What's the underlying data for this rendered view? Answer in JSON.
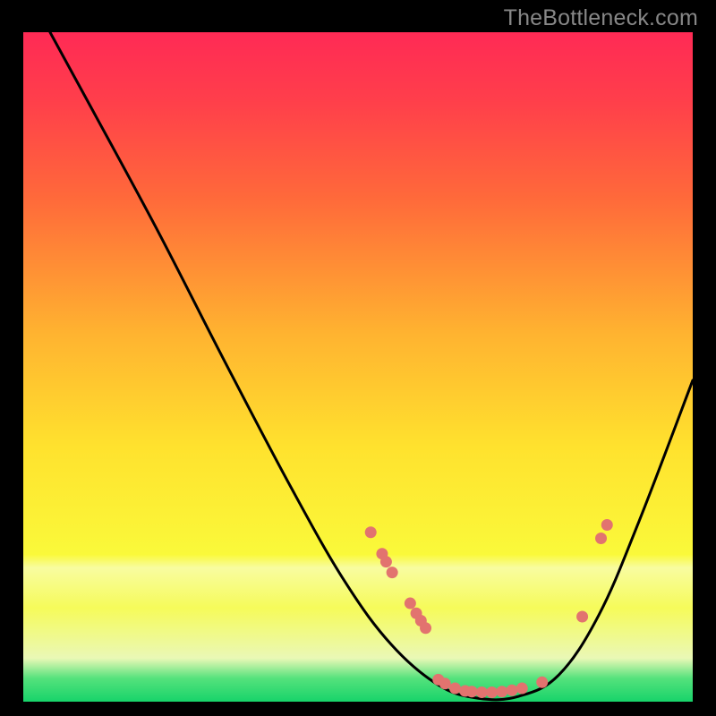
{
  "watermark": "TheBottleneck.com",
  "chart_data": {
    "type": "line",
    "title": "",
    "xlabel": "",
    "ylabel": "",
    "xlim": [
      0,
      100
    ],
    "ylim": [
      0,
      100
    ],
    "gradient_stops": [
      {
        "offset": 0.0,
        "color": "#ff2a55"
      },
      {
        "offset": 0.1,
        "color": "#ff3e4b"
      },
      {
        "offset": 0.25,
        "color": "#ff6a3a"
      },
      {
        "offset": 0.45,
        "color": "#ffb330"
      },
      {
        "offset": 0.62,
        "color": "#ffe22e"
      },
      {
        "offset": 0.78,
        "color": "#faf93a"
      },
      {
        "offset": 0.8,
        "color": "#f8fca0"
      },
      {
        "offset": 0.86,
        "color": "#f6fb5a"
      },
      {
        "offset": 0.935,
        "color": "#eaf8b6"
      },
      {
        "offset": 0.965,
        "color": "#55e27c"
      },
      {
        "offset": 1.0,
        "color": "#17d36a"
      }
    ],
    "series": [
      {
        "name": "bottleneck-curve",
        "color": "#000000",
        "stroke_width": 3,
        "points": [
          {
            "x": 4.0,
            "y": 100.0
          },
          {
            "x": 10.0,
            "y": 89.0
          },
          {
            "x": 20.0,
            "y": 70.5
          },
          {
            "x": 30.0,
            "y": 51.0
          },
          {
            "x": 40.0,
            "y": 32.0
          },
          {
            "x": 48.0,
            "y": 18.0
          },
          {
            "x": 55.0,
            "y": 8.5
          },
          {
            "x": 62.0,
            "y": 2.5
          },
          {
            "x": 68.0,
            "y": 0.5
          },
          {
            "x": 74.0,
            "y": 0.8
          },
          {
            "x": 80.0,
            "y": 4.0
          },
          {
            "x": 86.0,
            "y": 13.0
          },
          {
            "x": 92.0,
            "y": 27.0
          },
          {
            "x": 100.0,
            "y": 48.0
          }
        ]
      }
    ],
    "markers": {
      "color": "#e2736f",
      "radius": 6.5,
      "points": [
        {
          "x": 51.9,
          "y": 25.3
        },
        {
          "x": 53.6,
          "y": 22.1
        },
        {
          "x": 54.2,
          "y": 20.9
        },
        {
          "x": 55.1,
          "y": 19.3
        },
        {
          "x": 57.8,
          "y": 14.7
        },
        {
          "x": 58.7,
          "y": 13.2
        },
        {
          "x": 59.4,
          "y": 12.1
        },
        {
          "x": 60.1,
          "y": 11.0
        },
        {
          "x": 62.0,
          "y": 3.3
        },
        {
          "x": 63.0,
          "y": 2.7
        },
        {
          "x": 64.5,
          "y": 2.0
        },
        {
          "x": 66.0,
          "y": 1.6
        },
        {
          "x": 67.0,
          "y": 1.5
        },
        {
          "x": 68.5,
          "y": 1.4
        },
        {
          "x": 70.0,
          "y": 1.4
        },
        {
          "x": 71.5,
          "y": 1.5
        },
        {
          "x": 73.0,
          "y": 1.7
        },
        {
          "x": 74.5,
          "y": 2.0
        },
        {
          "x": 77.5,
          "y": 2.9
        },
        {
          "x": 83.5,
          "y": 12.7
        },
        {
          "x": 86.3,
          "y": 24.4
        },
        {
          "x": 87.2,
          "y": 26.4
        }
      ]
    }
  }
}
